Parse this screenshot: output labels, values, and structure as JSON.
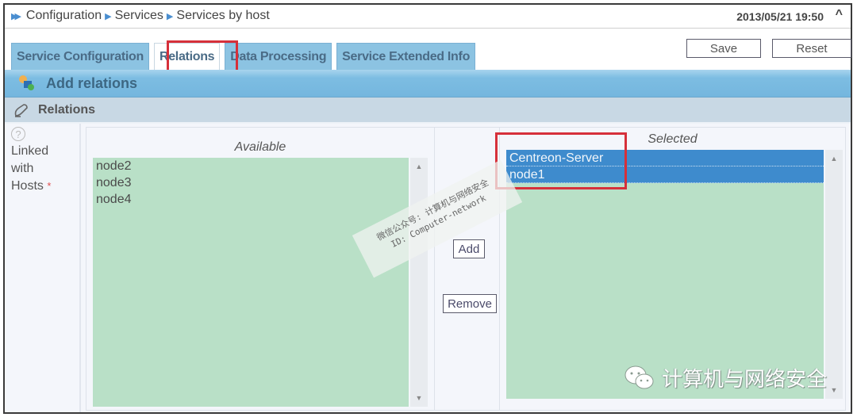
{
  "breadcrumb": {
    "items": [
      "Configuration",
      "Services",
      "Services by host"
    ]
  },
  "header": {
    "datetime": "2013/05/21 19:50",
    "collapse_glyph": "^"
  },
  "tabs": [
    {
      "label": "Service Configuration",
      "active": false
    },
    {
      "label": "Relations",
      "active": true
    },
    {
      "label": "Data Processing",
      "active": false
    },
    {
      "label": "Service Extended Info",
      "active": false
    }
  ],
  "toolbar": {
    "save_label": "Save",
    "reset_label": "Reset"
  },
  "sections": {
    "add_relations": "Add relations",
    "relations": "Relations"
  },
  "field": {
    "help_glyph": "?",
    "label_lines": [
      "Linked",
      "with",
      "Hosts"
    ],
    "required_mark": "*"
  },
  "available": {
    "title": "Available",
    "options": [
      "node2",
      "node3",
      "node4"
    ]
  },
  "selected": {
    "title": "Selected",
    "options": [
      "Centreon-Server",
      "node1"
    ]
  },
  "transfer": {
    "add_label": "Add",
    "remove_label": "Remove"
  },
  "watermark": {
    "line1": "微信公众号: 计算机与网络安全",
    "line2": "ID: Computer-network"
  },
  "brand": {
    "text": "计算机与网络安全"
  },
  "colors": {
    "tab_bg": "#8cc3e2",
    "header_bar": "#74b6de",
    "subheader_bar": "#c8d8e4",
    "list_bg": "#b9e0c7",
    "selection": "#3e8bcd",
    "highlight_box": "#d6303a"
  }
}
